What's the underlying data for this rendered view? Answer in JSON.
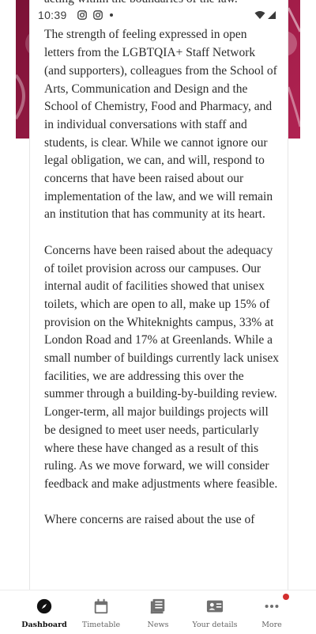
{
  "status_bar": {
    "time": "10:39",
    "left_icons": [
      "instagram-icon",
      "instagram-icon",
      "dot-icon"
    ],
    "right_icons": [
      "wifi-icon",
      "signal-icon"
    ]
  },
  "article": {
    "paragraphs": [
      "acting within the boundaries of the law.",
      "The strength of feeling expressed in open letters from the LGBTQIA+ Staff Network (and supporters), colleagues from the School of Arts, Communication and Design and the School of Chemistry, Food and Pharmacy, and in individual conversations with staff and students, is clear. While we cannot ignore our legal obligation, we can, and will, respond to concerns that have been raised about our implementation of the law, and we will remain an institution that has community at its heart.",
      "Concerns have been raised about the adequacy of toilet provision across our campuses. Our internal audit of facilities showed that unisex toilets, which are open to all, make up 15% of provision on the Whiteknights campus, 33% at London Road and 17% at Greenlands. While a small number of buildings currently lack unisex facilities, we are addressing this over the summer through a building-by-building review. Longer-term, all major buildings projects will be designed to meet user needs, particularly where these have changed as a result of this ruling. As we move forward, we will consider feedback and make adjustments where feasible.",
      "Where concerns are raised about the use of"
    ]
  },
  "bottom_nav": {
    "items": [
      {
        "label": "Dashboard",
        "icon": "compass-icon",
        "active": true
      },
      {
        "label": "Timetable",
        "icon": "calendar-icon",
        "active": false
      },
      {
        "label": "News",
        "icon": "newspaper-icon",
        "active": false
      },
      {
        "label": "Your details",
        "icon": "id-card-icon",
        "active": false
      },
      {
        "label": "More",
        "icon": "more-dots-icon",
        "active": false,
        "badge": true
      }
    ]
  },
  "colors": {
    "accent_maroon": "#9e1b46",
    "notification_red": "#d32f2f",
    "text": "#2b2b2b"
  }
}
